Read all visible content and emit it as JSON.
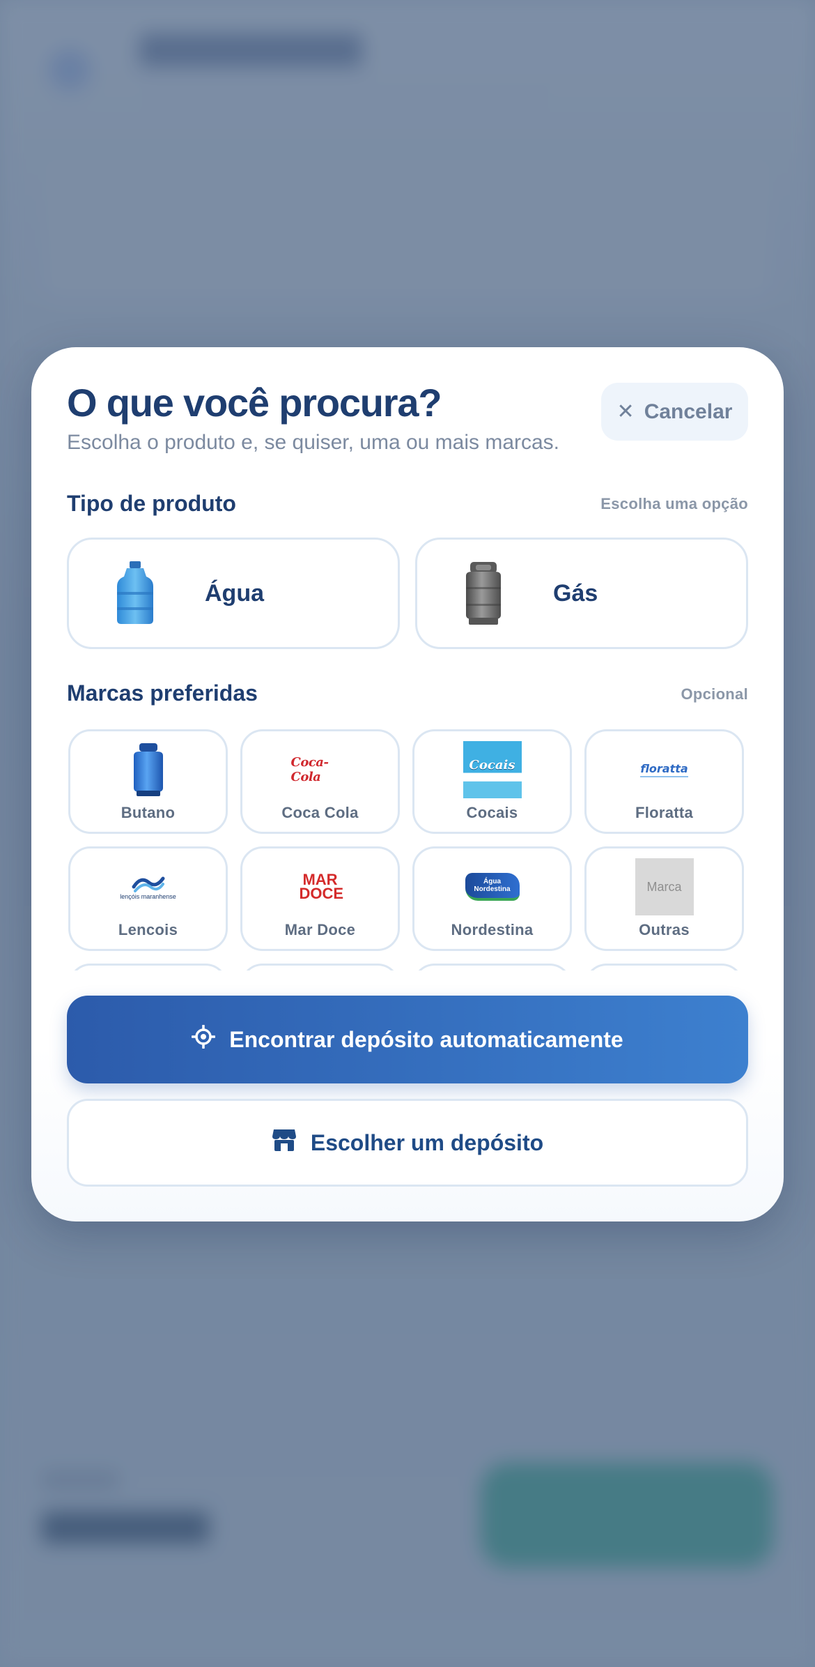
{
  "modal": {
    "title": "O que você procura?",
    "subtitle": "Escolha o produto e, se quiser, uma ou mais marcas.",
    "cancel_label": "Cancelar"
  },
  "product_type": {
    "title": "Tipo de produto",
    "hint": "Escolha uma opção",
    "options": [
      {
        "label": "Água",
        "icon": "water-jug-icon"
      },
      {
        "label": "Gás",
        "icon": "gas-cylinder-icon"
      }
    ]
  },
  "brands": {
    "title": "Marcas preferidas",
    "hint": "Opcional",
    "items": [
      {
        "name": "Butano",
        "logo": "gas-cylinder-blue"
      },
      {
        "name": "Coca Cola",
        "logo_text": "Coca-Cola"
      },
      {
        "name": "Cocais",
        "logo_text": "Cocais"
      },
      {
        "name": "Floratta",
        "logo_text": "floratta"
      },
      {
        "name": "Lencois",
        "logo_text": "lençóis maranhense"
      },
      {
        "name": "Mar Doce",
        "logo_text": "MAR DOCE"
      },
      {
        "name": "Nordestina",
        "logo_text": "Água Nordestina"
      },
      {
        "name": "Outras",
        "logo_text": "Marca"
      }
    ]
  },
  "actions": {
    "auto_find_label": "Encontrar depósito automaticamente",
    "choose_label": "Escolher um depósito"
  },
  "colors": {
    "primary": "#2c5bab",
    "primary_end": "#3d80cf",
    "heading": "#1f3e70",
    "muted": "#7c8aa0",
    "border": "#dbe6f2"
  }
}
